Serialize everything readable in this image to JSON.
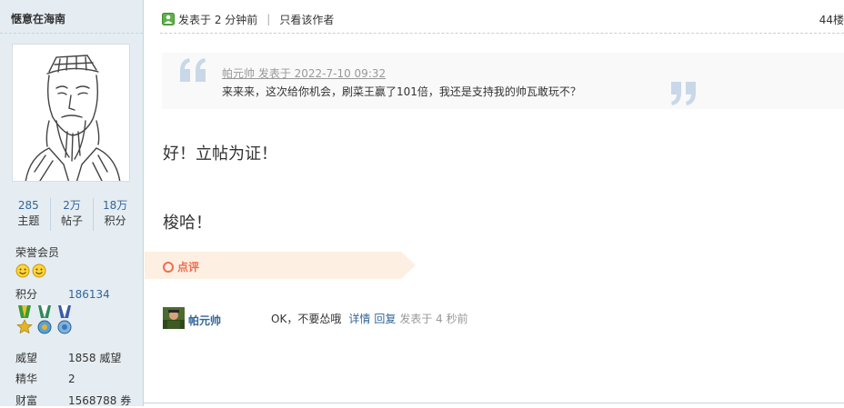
{
  "profile": {
    "username": "惬意在海南",
    "stats": [
      {
        "num": "285",
        "label": "主题"
      },
      {
        "num": "2万",
        "label": "帖子"
      },
      {
        "num": "18万",
        "label": "积分"
      }
    ],
    "rank": "荣誉会员",
    "points_label": "积分",
    "points_value": "186134",
    "prestige_label": "威望",
    "prestige_value": "1858 威望",
    "elite_label": "精华",
    "elite_value": "2",
    "wealth_label": "财富",
    "wealth_value": "1568788 券"
  },
  "post": {
    "posted": "发表于 2 分钟前",
    "only_author": "只看该作者",
    "floor": "44楼",
    "quote_head": "帕元帅 发表于 2022-7-10 09:32",
    "quote_text": "来来来，这次给你机会，刷菜王赢了101倍，我还是支持我的帅瓦敢玩不？",
    "message_1": "好！立帖为证！",
    "message_2": "梭哈！"
  },
  "comments": {
    "label": "点评",
    "items": [
      {
        "user": "帕元帅",
        "text": "OK，不要怂哦",
        "detail": "详情",
        "reply": "回复",
        "time": "发表于 4 秒前"
      }
    ]
  },
  "colors": {
    "sidebar_bg": "#e5edf2",
    "link": "#336699",
    "accent": "#f26c4f",
    "comment_bar": "#fdf0e2"
  }
}
